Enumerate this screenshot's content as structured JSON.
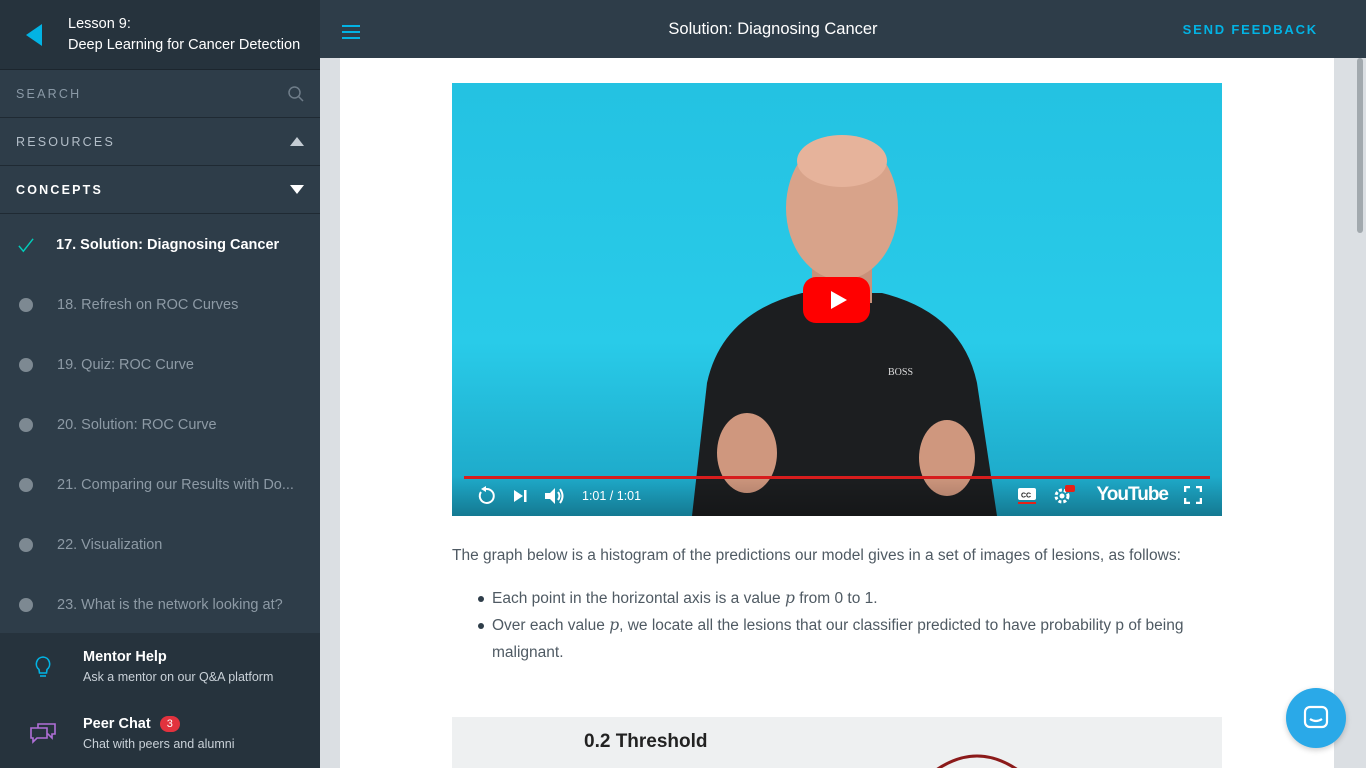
{
  "lesson": {
    "line1": "Lesson 9:",
    "line2": "Deep Learning for Cancer Detection"
  },
  "sidebar": {
    "search_label": "SEARCH",
    "resources_label": "RESOURCES",
    "concepts_label": "CONCEPTS",
    "concepts": [
      {
        "label": "17. Solution: Diagnosing Cancer",
        "state": "active"
      },
      {
        "label": "18. Refresh on ROC Curves",
        "state": "pending"
      },
      {
        "label": "19. Quiz: ROC Curve",
        "state": "pending"
      },
      {
        "label": "20. Solution: ROC Curve",
        "state": "pending"
      },
      {
        "label": "21. Comparing our Results with Do...",
        "state": "pending"
      },
      {
        "label": "22. Visualization",
        "state": "pending"
      },
      {
        "label": "23. What is the network looking at?",
        "state": "pending"
      }
    ],
    "help": {
      "mentor_title": "Mentor Help",
      "mentor_sub": "Ask a mentor on our Q&A platform",
      "peer_title": "Peer Chat",
      "peer_badge": "3",
      "peer_sub": "Chat with peers and alumni"
    }
  },
  "header": {
    "title": "Solution: Diagnosing Cancer",
    "feedback": "SEND FEEDBACK"
  },
  "video": {
    "time": "1:01 / 1:01",
    "logo": "YouTube",
    "shirt_text": "BOSS"
  },
  "content": {
    "intro": "The graph below is a histogram of the predictions our model gives in a set of images of lesions, as follows:",
    "bullet1_a": "Each point in the horizontal axis is a value ",
    "bullet1_var": "p",
    "bullet1_b": " from 0 to 1.",
    "bullet2_a": "Over each value ",
    "bullet2_var": "p",
    "bullet2_b": ", we locate all the lesions that our classifier predicted to have probability p of being malignant.",
    "figure_title": "0.2 Threshold"
  },
  "colors": {
    "accent": "#02b3e4",
    "sidebar": "#2e3d49",
    "badge": "#e2323e",
    "youtube_red": "#ff0000"
  }
}
